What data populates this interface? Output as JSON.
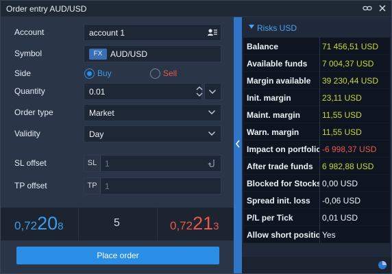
{
  "window": {
    "title": "Order entry AUD/USD",
    "link_icon": "link-icon",
    "close_icon": "close-icon"
  },
  "form": {
    "account": {
      "label": "Account",
      "value": "account 1",
      "icon": "account-list-icon"
    },
    "symbol": {
      "label": "Symbol",
      "badge": "FX",
      "value": "AUD/USD"
    },
    "side": {
      "label": "Side",
      "buy_label": "Buy",
      "sell_label": "Sell",
      "selected": "Buy"
    },
    "quantity": {
      "label": "Quantity",
      "value": "0.01"
    },
    "order_type": {
      "label": "Order type",
      "value": "Market"
    },
    "validity": {
      "label": "Validity",
      "value": "Day"
    },
    "sl_offset": {
      "label": "SL offset",
      "prefix": "SL",
      "placeholder": "1"
    },
    "tp_offset": {
      "label": "TP offset",
      "prefix": "TP",
      "placeholder": "1"
    }
  },
  "quote": {
    "bid": {
      "small": "0,72",
      "big": "20",
      "tiny": "8"
    },
    "spread": "5",
    "ask": {
      "small": "0,72",
      "big": "21",
      "tiny": "3"
    }
  },
  "place_order_label": "Place order",
  "risks": {
    "header": "Risks USD",
    "rows": [
      {
        "key": "Balance",
        "value": "71 456,51 USD",
        "tone": "positive"
      },
      {
        "key": "Available  funds",
        "value": "7 004,37 USD",
        "tone": "positive"
      },
      {
        "key": "Margin available",
        "value": "39 230,44 USD",
        "tone": "positive"
      },
      {
        "key": "Init. margin",
        "value": "23,11 USD",
        "tone": "positive"
      },
      {
        "key": "Maint. margin",
        "value": "11,55 USD",
        "tone": "positive"
      },
      {
        "key": "Warn. margin",
        "value": "11,55 USD",
        "tone": "positive"
      },
      {
        "key": "Impact on portfolio",
        "value": "-6 998,37 USD",
        "tone": "negative"
      },
      {
        "key": "After trade funds",
        "value": "6 982,88 USD",
        "tone": "positive"
      },
      {
        "key": "Blocked for Stocks",
        "value": "0,00 USD",
        "tone": "neutral"
      },
      {
        "key": "Spread init. loss",
        "value": "-0,06 USD",
        "tone": "neutral"
      },
      {
        "key": "P/L per Tick",
        "value": "0,01 USD",
        "tone": "neutral"
      },
      {
        "key": "Allow short position",
        "value": "Yes",
        "tone": "neutral"
      }
    ]
  },
  "colors": {
    "accent": "#2a8de6",
    "positive": "#c6d83a",
    "negative": "#e8584c",
    "neutral": "#eef2f7",
    "bid": "#3f9ae8",
    "ask": "#e8584c"
  }
}
